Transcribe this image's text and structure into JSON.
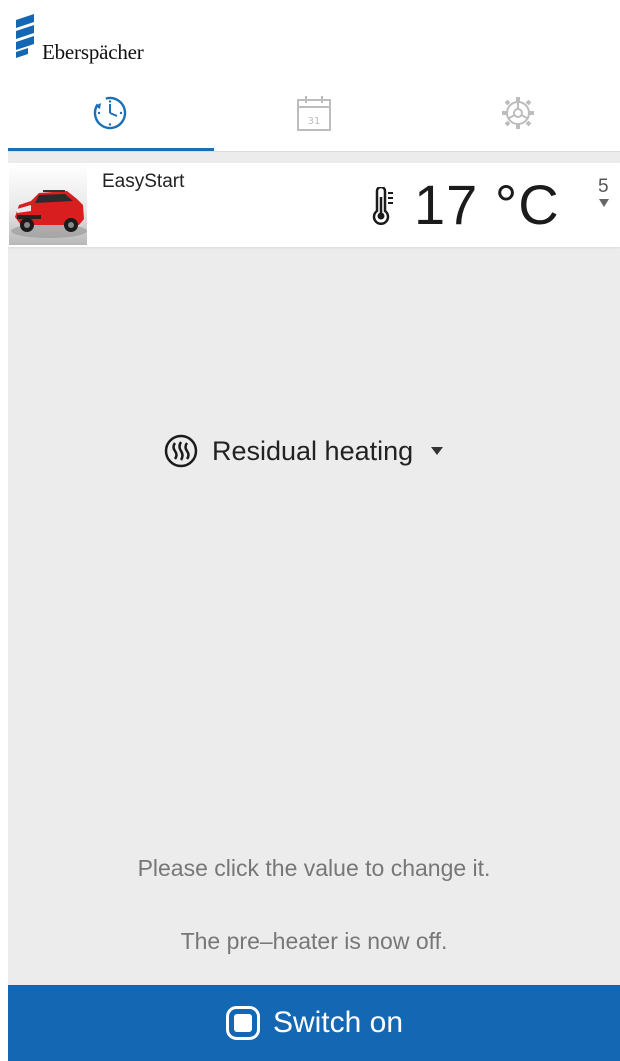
{
  "header": {
    "brand": "Eberspächer",
    "brand_color": "#1467b3"
  },
  "tabs": [
    {
      "name": "timer",
      "icon": "clock-icon",
      "active": true
    },
    {
      "name": "calendar",
      "icon": "calendar-icon",
      "label": "31",
      "active": false
    },
    {
      "name": "settings",
      "icon": "gear-icon",
      "active": false
    }
  ],
  "vehicle": {
    "name": "EasyStart",
    "image": "red-suv",
    "temperature": "17 °C",
    "next_value": "5"
  },
  "mode": {
    "icon": "residual-heat-icon",
    "label": "Residual heating"
  },
  "messages": {
    "hint": "Please click the value to change it.",
    "status": "The pre–heater is now off."
  },
  "action": {
    "icon": "power-square-icon",
    "label": "Switch on"
  }
}
